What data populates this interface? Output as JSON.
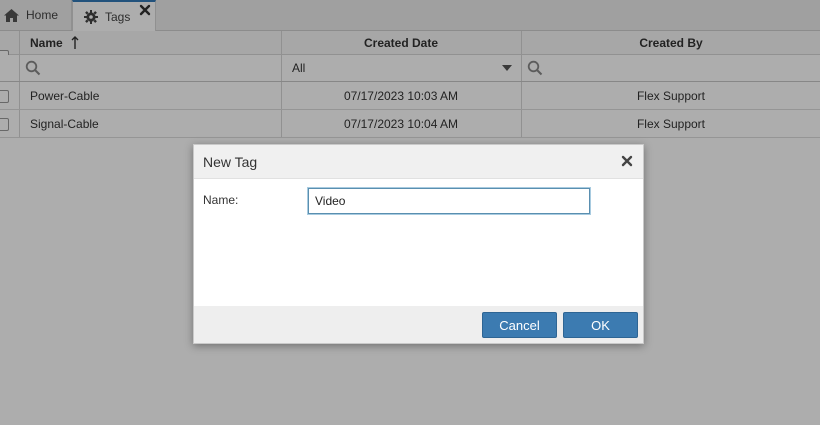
{
  "tabs": {
    "home_label": "Home",
    "tags_label": "Tags"
  },
  "grid": {
    "columns": {
      "name": "Name",
      "created_date": "Created Date",
      "created_by": "Created By"
    },
    "filter": {
      "date_selected": "All"
    },
    "rows": [
      {
        "name": "Power-Cable",
        "created_date": "07/17/2023 10:03 AM",
        "created_by": "Flex Support"
      },
      {
        "name": "Signal-Cable",
        "created_date": "07/17/2023 10:04 AM",
        "created_by": "Flex Support"
      }
    ]
  },
  "dialog": {
    "title": "New Tag",
    "name_label": "Name:",
    "name_value": "Video",
    "cancel_label": "Cancel",
    "ok_label": "OK"
  },
  "colors": {
    "accent": "#337ab7",
    "button": "#3c7bb1"
  },
  "icons": {
    "home": "home-icon",
    "tags": "gear-icon",
    "close": "close-icon",
    "search": "search-icon",
    "sort": "sort-ascending-icon",
    "dropdown": "caret-down-icon"
  }
}
